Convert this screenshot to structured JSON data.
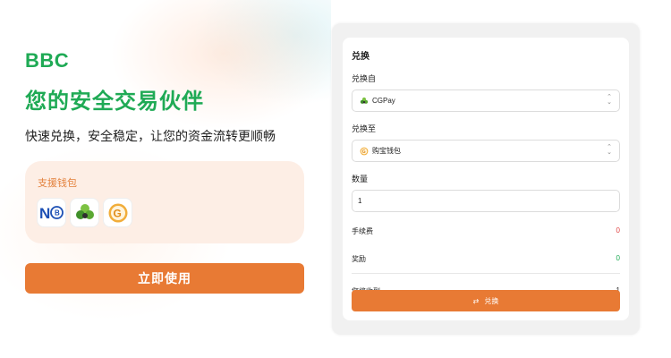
{
  "hero": {
    "brand": "BBC",
    "tagline": "您的安全交易伙伴",
    "subtitle": "快速兑换，安全稳定，让您的资金流转更顺畅"
  },
  "wallets": {
    "title": "支援钱包",
    "icons": [
      "nb-wallet-icon",
      "cgpay-icon",
      "goubao-icon"
    ]
  },
  "cta": {
    "label": "立即使用"
  },
  "exchange": {
    "title": "兑换",
    "from_label": "兑换自",
    "from_value": "CGPay",
    "to_label": "兑换至",
    "to_value": "购宝钱包",
    "amount_label": "数量",
    "amount_value": "1",
    "fee_label": "手续费",
    "fee_value": "0",
    "reward_label": "奖励",
    "reward_value": "0",
    "receive_label": "您将收到",
    "receive_value": "1",
    "submit_label": "兑换"
  },
  "colors": {
    "brand_green": "#1faa55",
    "accent_orange": "#e87a34",
    "fee_red": "#e04545"
  }
}
